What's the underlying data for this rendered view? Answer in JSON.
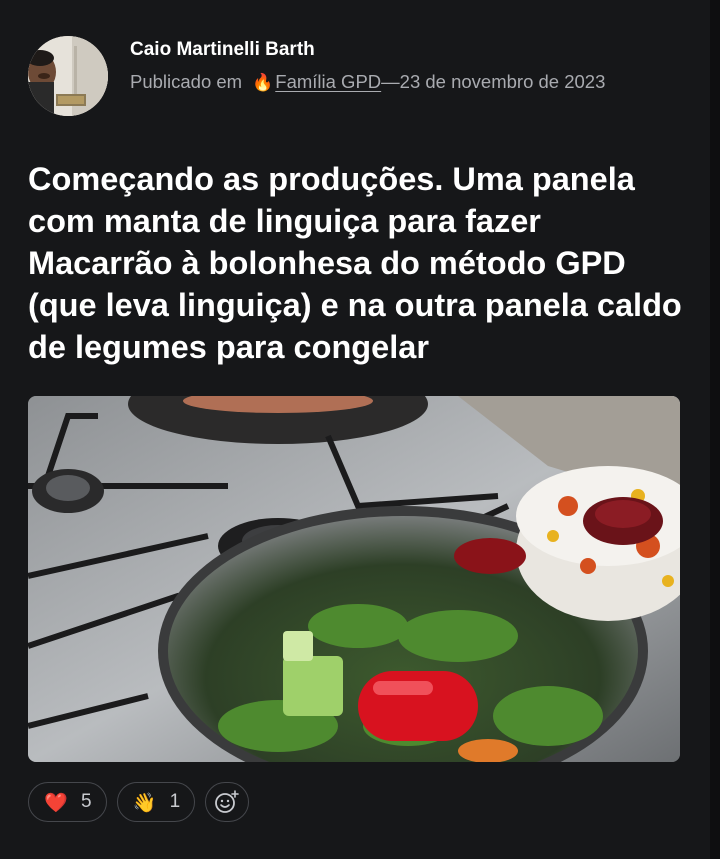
{
  "post": {
    "author": {
      "name": "Caio Martinelli Barth"
    },
    "meta": {
      "published_prefix": "Publicado em",
      "community_icon": "fire-emoji",
      "community_icon_glyph": "🔥",
      "community_name": "Família GPD",
      "date_separator": "—23 de novembro de 2023"
    },
    "title": "Começando as produções. Uma panela com manta de linguiça para fazer Macarrão à bolonhesa do método GPD (que leva linguiça) e na outra panela caldo de legumes para congelar",
    "reactions": [
      {
        "icon": "red-heart-emoji",
        "glyph": "❤️",
        "count": "5"
      },
      {
        "icon": "waving-hand-emoji",
        "glyph": "👋",
        "count": "1"
      }
    ],
    "add_reaction_icon": "add-reaction-icon"
  },
  "colors": {
    "background": "#161719",
    "title_text": "#ffffff",
    "meta_text": "#a9abb0",
    "pill_border": "#45474c"
  }
}
